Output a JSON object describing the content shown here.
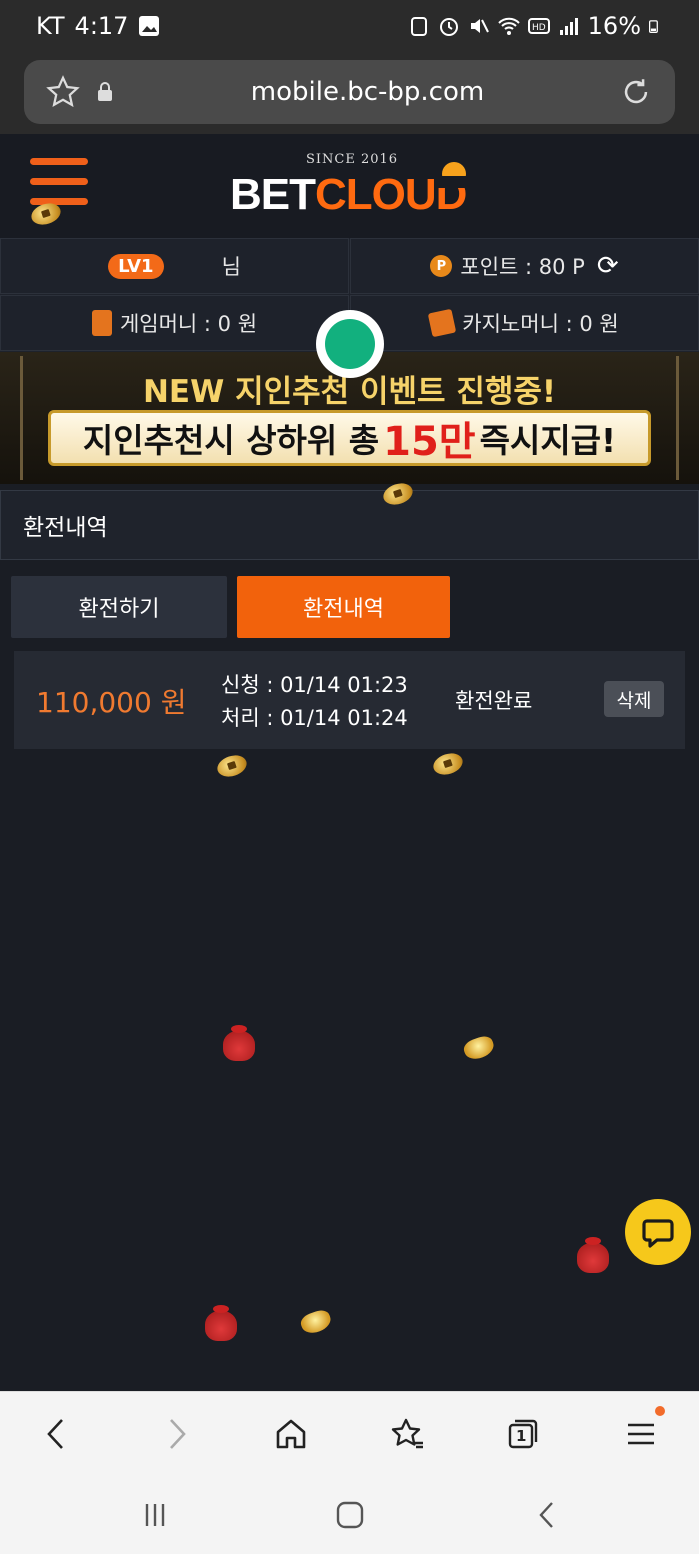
{
  "status_bar": {
    "carrier": "KT",
    "time": "4:17",
    "battery": "16%"
  },
  "browser": {
    "url": "mobile.bc-bp.com",
    "tab_count": "1"
  },
  "header": {
    "since": "SINCE 2016",
    "brand_white": "BET",
    "brand_orange": "CLOUD"
  },
  "user_info": {
    "level": "LV1",
    "name_suffix": "님",
    "points": "포인트 : 80 P",
    "game_money": "게임머니 : 0 원",
    "casino_money": "카지노머니 : 0 원"
  },
  "banner": {
    "line1": "NEW 지인추천 이벤트 진행중!",
    "line2_prefix": "지인추천시 상하위 총",
    "line2_highlight": "15만",
    "line2_suffix": "즉시지급!"
  },
  "page": {
    "section_title": "환전내역",
    "tabs": [
      {
        "label": "환전하기",
        "active": false
      },
      {
        "label": "환전내역",
        "active": true
      }
    ]
  },
  "history": [
    {
      "amount": "110,000 원",
      "requested": "신청 : 01/14 01:23",
      "processed": "처리 : 01/14 01:24",
      "status": "환전완료",
      "delete_label": "삭제"
    }
  ],
  "colors": {
    "accent": "#f2620c",
    "background": "#1a1d24",
    "chat_button": "#f6c81b"
  }
}
